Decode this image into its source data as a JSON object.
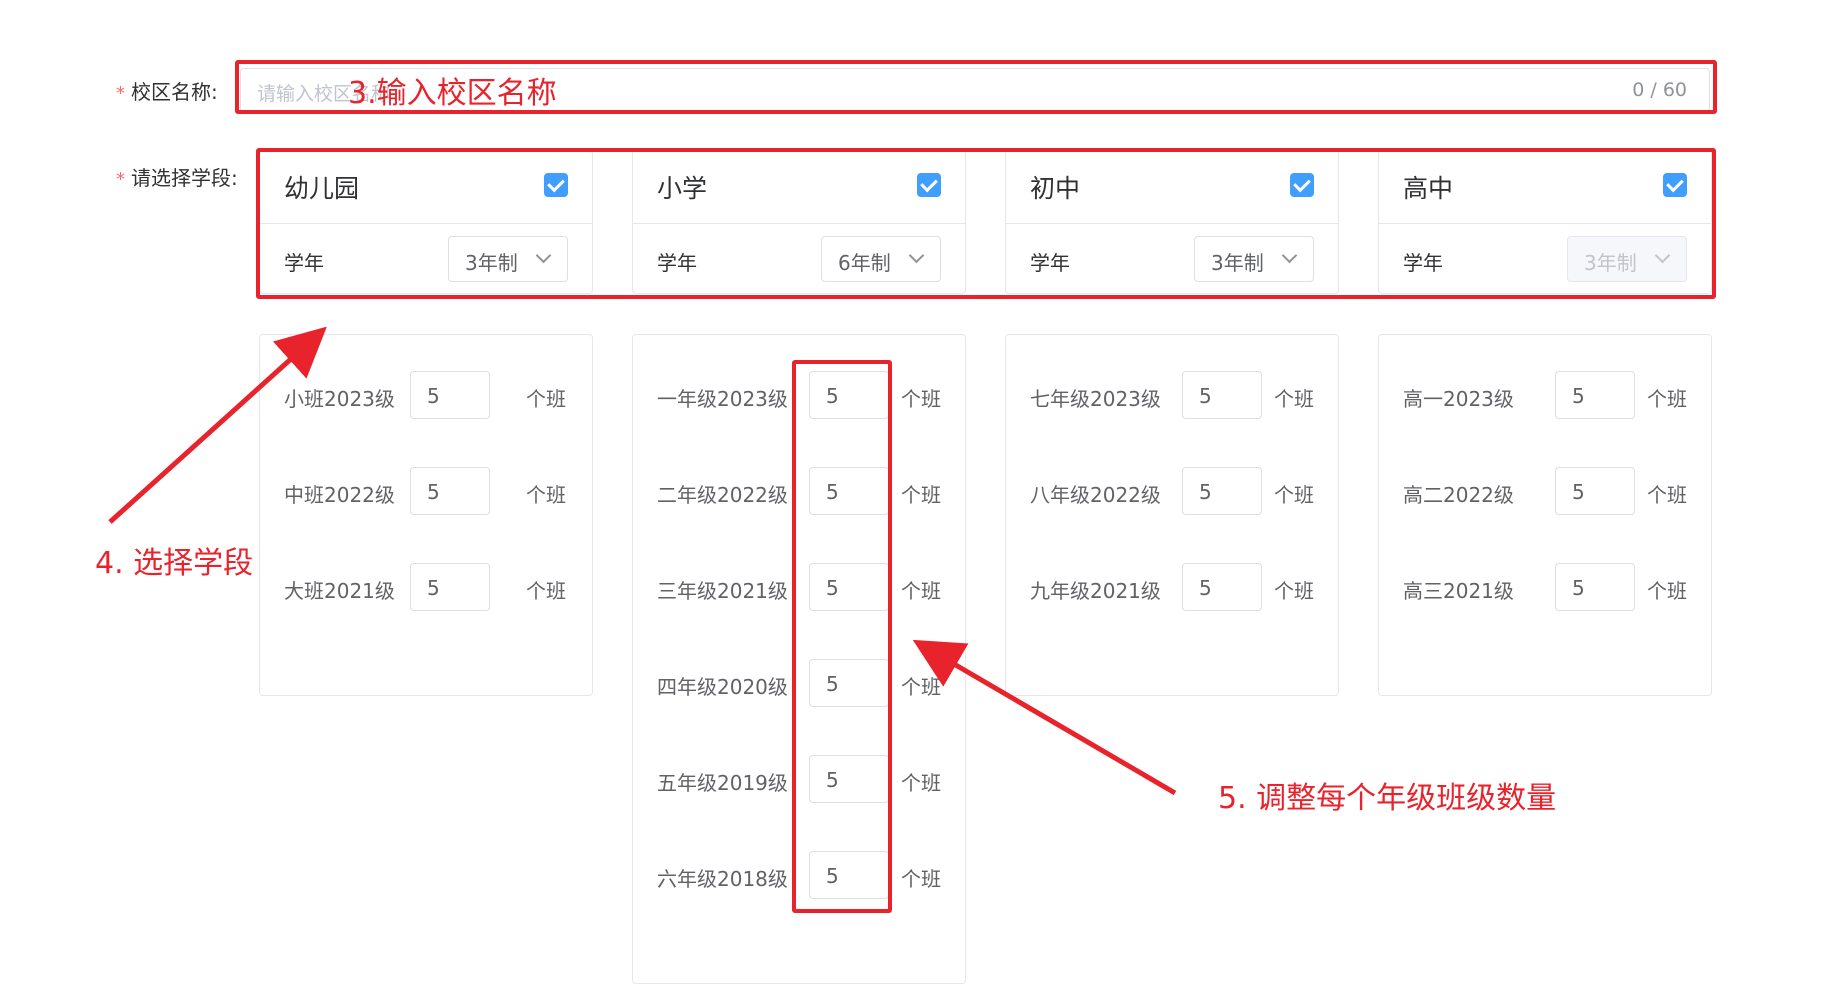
{
  "form": {
    "campus_name_label": "校区名称:",
    "campus_name_placeholder": "请输入校区名称",
    "campus_name_count": "0 / 60",
    "stage_label": "请选择学段:",
    "required_mark": "*"
  },
  "stages": [
    {
      "title": "幼儿园",
      "checked": true,
      "year_label": "学年",
      "year_value": "3年制",
      "disabled": false,
      "grades": [
        {
          "label": "小班2023级",
          "count": "5",
          "unit": "个班"
        },
        {
          "label": "中班2022级",
          "count": "5",
          "unit": "个班"
        },
        {
          "label": "大班2021级",
          "count": "5",
          "unit": "个班"
        }
      ]
    },
    {
      "title": "小学",
      "checked": true,
      "year_label": "学年",
      "year_value": "6年制",
      "disabled": false,
      "grades": [
        {
          "label": "一年级2023级",
          "count": "5",
          "unit": "个班"
        },
        {
          "label": "二年级2022级",
          "count": "5",
          "unit": "个班"
        },
        {
          "label": "三年级2021级",
          "count": "5",
          "unit": "个班"
        },
        {
          "label": "四年级2020级",
          "count": "5",
          "unit": "个班"
        },
        {
          "label": "五年级2019级",
          "count": "5",
          "unit": "个班"
        },
        {
          "label": "六年级2018级",
          "count": "5",
          "unit": "个班"
        }
      ]
    },
    {
      "title": "初中",
      "checked": true,
      "year_label": "学年",
      "year_value": "3年制",
      "disabled": false,
      "grades": [
        {
          "label": "七年级2023级",
          "count": "5",
          "unit": "个班"
        },
        {
          "label": "八年级2022级",
          "count": "5",
          "unit": "个班"
        },
        {
          "label": "九年级2021级",
          "count": "5",
          "unit": "个班"
        }
      ]
    },
    {
      "title": "高中",
      "checked": true,
      "year_label": "学年",
      "year_value": "3年制",
      "disabled": true,
      "grades": [
        {
          "label": "高一2023级",
          "count": "5",
          "unit": "个班"
        },
        {
          "label": "高二2022级",
          "count": "5",
          "unit": "个班"
        },
        {
          "label": "高三2021级",
          "count": "5",
          "unit": "个班"
        }
      ]
    }
  ],
  "annotations": {
    "step3": "3.输入校区名称",
    "step4": "4. 选择学段",
    "step5": "5. 调整每个年级班级数量",
    "color": "#e8232c"
  },
  "colors": {
    "primary": "#409eff",
    "border": "#dcdfe6",
    "required": "#f56c6c"
  }
}
